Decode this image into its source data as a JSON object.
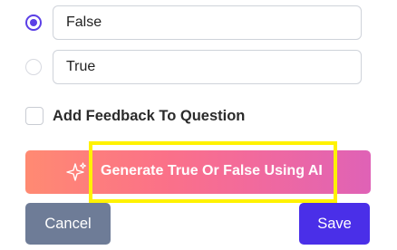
{
  "options": [
    {
      "value": "False",
      "selected": true
    },
    {
      "value": "True",
      "selected": false
    }
  ],
  "feedback": {
    "label": "Add Feedback To Question",
    "checked": false
  },
  "ai_button": {
    "label": "Generate True Or False Using AI",
    "icon": "sparkles-icon"
  },
  "actions": {
    "cancel_label": "Cancel",
    "save_label": "Save"
  },
  "colors": {
    "radio_accent": "#5b3fe6",
    "save_bg": "#4a2fe8",
    "cancel_bg": "#6e7c97",
    "ai_gradient_start": "#ff8a72",
    "ai_gradient_end": "#df62b6",
    "highlight": "#fff200"
  }
}
